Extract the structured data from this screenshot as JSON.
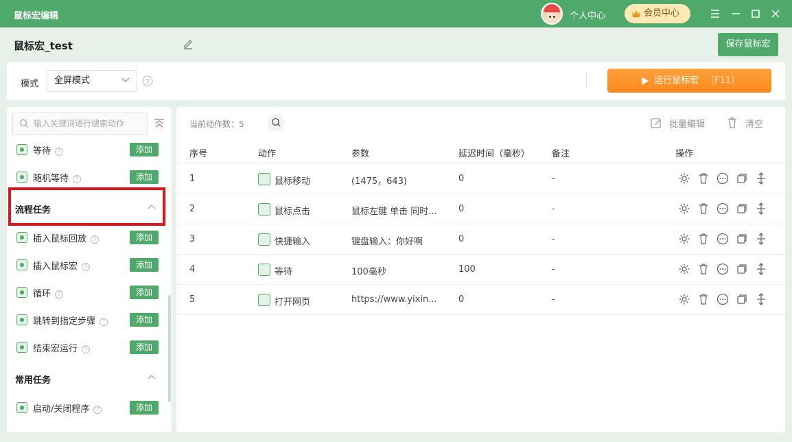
{
  "window": {
    "title": "鼠标宏编辑",
    "user_center": "个人中心",
    "vip": "会员中心"
  },
  "header": {
    "macro_name": "鼠标宏_test",
    "save_label": "保存鼠标宏"
  },
  "toolbar": {
    "mode_label": "模式",
    "mode_value": "全屏模式",
    "run_label": "运行鼠标宏",
    "run_shortcut": "（F11）"
  },
  "sidebar": {
    "search_placeholder": "输入关键词进行搜索动作",
    "add_label": "添加",
    "top_items": [
      {
        "label": "等待"
      },
      {
        "label": "随机等待"
      }
    ],
    "groups": [
      {
        "title": "流程任务",
        "items": [
          {
            "label": "插入鼠标回放"
          },
          {
            "label": "插入鼠标宏"
          },
          {
            "label": "循环"
          },
          {
            "label": "跳转到指定步骤"
          },
          {
            "label": "结束宏运行"
          }
        ]
      },
      {
        "title": "常用任务",
        "items": [
          {
            "label": "启动/关闭程序"
          }
        ]
      }
    ]
  },
  "main": {
    "count_label": "当前动作数：",
    "count": "5",
    "batch_edit": "批量编辑",
    "clear": "清空",
    "columns": {
      "index": "序号",
      "action": "动作",
      "params": "参数",
      "delay": "延迟时间（毫秒）",
      "note": "备注",
      "ops": "操作"
    },
    "rows": [
      {
        "index": "1",
        "action": "鼠标移动",
        "params": "(1475，643)",
        "delay": "0",
        "note": "-"
      },
      {
        "index": "2",
        "action": "鼠标点击",
        "params": "鼠标左键 单击 同时...",
        "delay": "0",
        "note": "-"
      },
      {
        "index": "3",
        "action": "快捷输入",
        "params": "键盘输入：你好啊",
        "delay": "0",
        "note": "-"
      },
      {
        "index": "4",
        "action": "等待",
        "params": "100毫秒",
        "delay": "100",
        "note": "-"
      },
      {
        "index": "5",
        "action": "打开网页",
        "params": "https://www.yixin...",
        "delay": "0",
        "note": "-"
      }
    ]
  },
  "colors": {
    "brand": "#4ea96a",
    "run": "#ff8a1f",
    "highlight": "#e4141b"
  }
}
